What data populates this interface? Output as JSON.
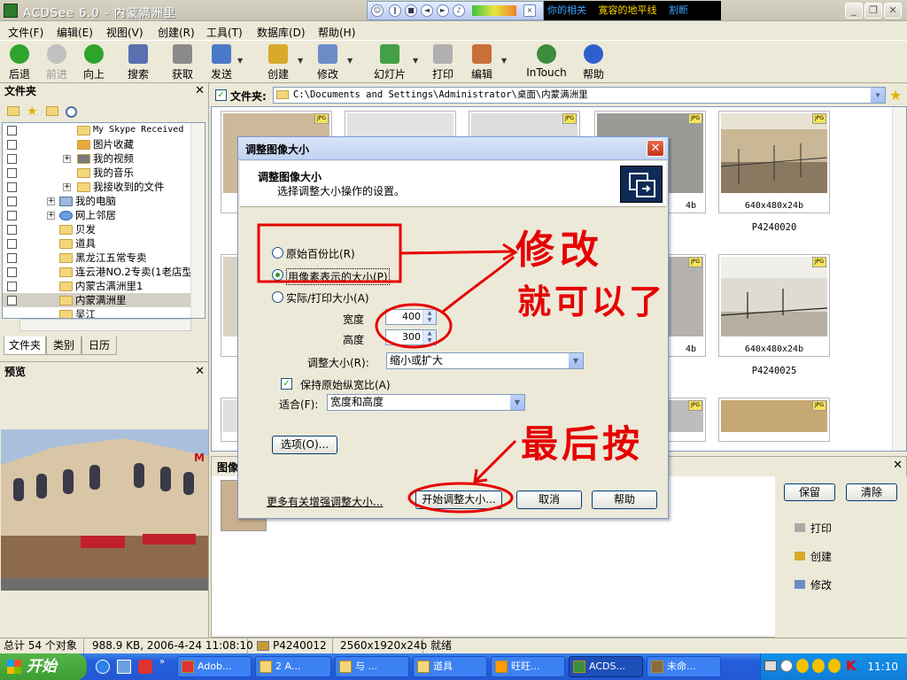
{
  "window": {
    "title": "ACDSee 6.0 - 内蒙满洲里",
    "lyric_a": "你的相关",
    "lyric_b": "寛容的地平线",
    "lyric_c": "割断"
  },
  "menu": [
    "文件(F)",
    "编辑(E)",
    "视图(V)",
    "创建(R)",
    "工具(T)",
    "数据库(D)",
    "帮助(H)"
  ],
  "toolbar": {
    "back": "后退",
    "forward": "前进",
    "up": "向上",
    "search": "搜索",
    "acquire": "获取",
    "send": "发送",
    "create": "创建",
    "modify": "修改",
    "slideshow": "幻灯片",
    "print": "打印",
    "edit": "编辑",
    "intouch": "InTouch",
    "help": "帮助"
  },
  "folders_panel": {
    "title": "文件夹",
    "tree": [
      "My Skype Received",
      "图片收藏",
      "我的视频",
      "我的音乐",
      "我接收到的文件",
      "我的电脑",
      "网上邻居",
      "贝发",
      "道具",
      "黑龙江五常专卖",
      "连云港NO.2专卖(1老店型",
      "内蒙古满洲里1",
      "内蒙满洲里",
      "吴江"
    ],
    "tabs": [
      "文件夹",
      "类别",
      "日历"
    ]
  },
  "preview_panel": {
    "title": "预览"
  },
  "pathbar": {
    "label": "文件夹:",
    "path": "C:\\Documents and Settings\\Administrator\\桌面\\内蒙满洲里"
  },
  "thumbs": [
    {
      "info": "640x480x24b",
      "name": "P4240020"
    },
    {
      "info": "640x480x24b",
      "name": "P4240025"
    }
  ],
  "hidden_thumb_infos": {
    "a": "4b",
    "b": "4b"
  },
  "bottom_panel": {
    "title": "图像",
    "keep": "保留",
    "clear": "清除",
    "print": "打印",
    "create": "创建",
    "modify": "修改"
  },
  "status": {
    "total": "总计 54 个对象",
    "size": "988.9 KB, 2006-4-24 11:08:10",
    "name": "P4240012",
    "dims": "2560x1920x24b",
    "ready": "就绪"
  },
  "taskbar": {
    "start": "开始",
    "tasks": [
      "Adob...",
      "2 A...",
      "与 ...",
      "道具",
      "旺旺...",
      "ACDS...",
      "未命..."
    ],
    "clock": "11:10"
  },
  "dialog": {
    "title": "调整图像大小",
    "header_title": "调整图像大小",
    "header_sub": "选择调整大小操作的设置。",
    "opt_percent": "原始百份比(R)",
    "opt_pixels": "用像素表示的大小(P)",
    "opt_print": "实际/打印大小(A)",
    "width_label": "宽度",
    "width_value": "400",
    "height_label": "高度",
    "height_value": "300",
    "resize_label": "调整大小(R):",
    "resize_value": "缩小或扩大",
    "keep_ratio": "保持原始纵宽比(A)",
    "fit_label": "适合(F):",
    "fit_value": "宽度和高度",
    "options_btn": "选项(O)...",
    "more_link": "更多有关增强调整大小...",
    "start_btn": "开始调整大小...",
    "cancel_btn": "取消",
    "help_btn": "帮助"
  },
  "annotations": {
    "note1_line1": "修改",
    "note1_line2": "就可以了",
    "note2": "最后按"
  }
}
